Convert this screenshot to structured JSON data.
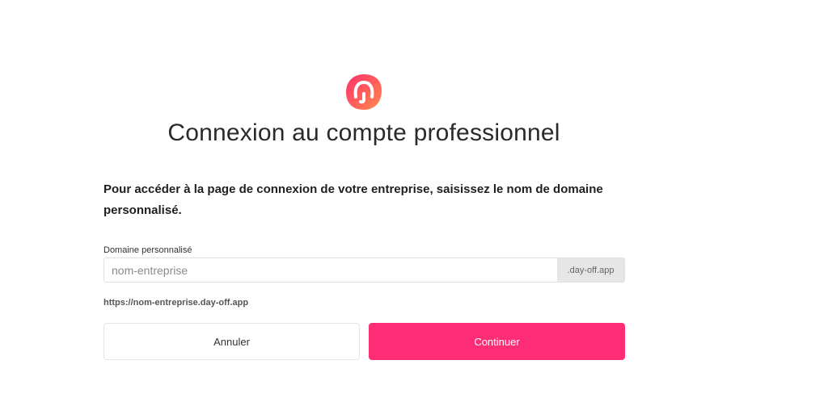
{
  "brand": {
    "logo_icon": "day-off-logo-icon",
    "gradient_start": "#ff2f6d",
    "gradient_end": "#ff8a4a"
  },
  "page": {
    "title": "Connexion au compte professionnel",
    "instructions": "Pour accéder à la page de connexion de votre entreprise, saisissez le nom de domaine personnalisé."
  },
  "form": {
    "domain_label": "Domaine personnalisé",
    "domain_value": "",
    "domain_placeholder": "nom-entreprise",
    "domain_suffix": ".day-off.app",
    "url_preview": "https://nom-entreprise.day-off.app"
  },
  "actions": {
    "cancel_label": "Annuler",
    "continue_label": "Continuer",
    "accent_color": "#ff2d76"
  }
}
